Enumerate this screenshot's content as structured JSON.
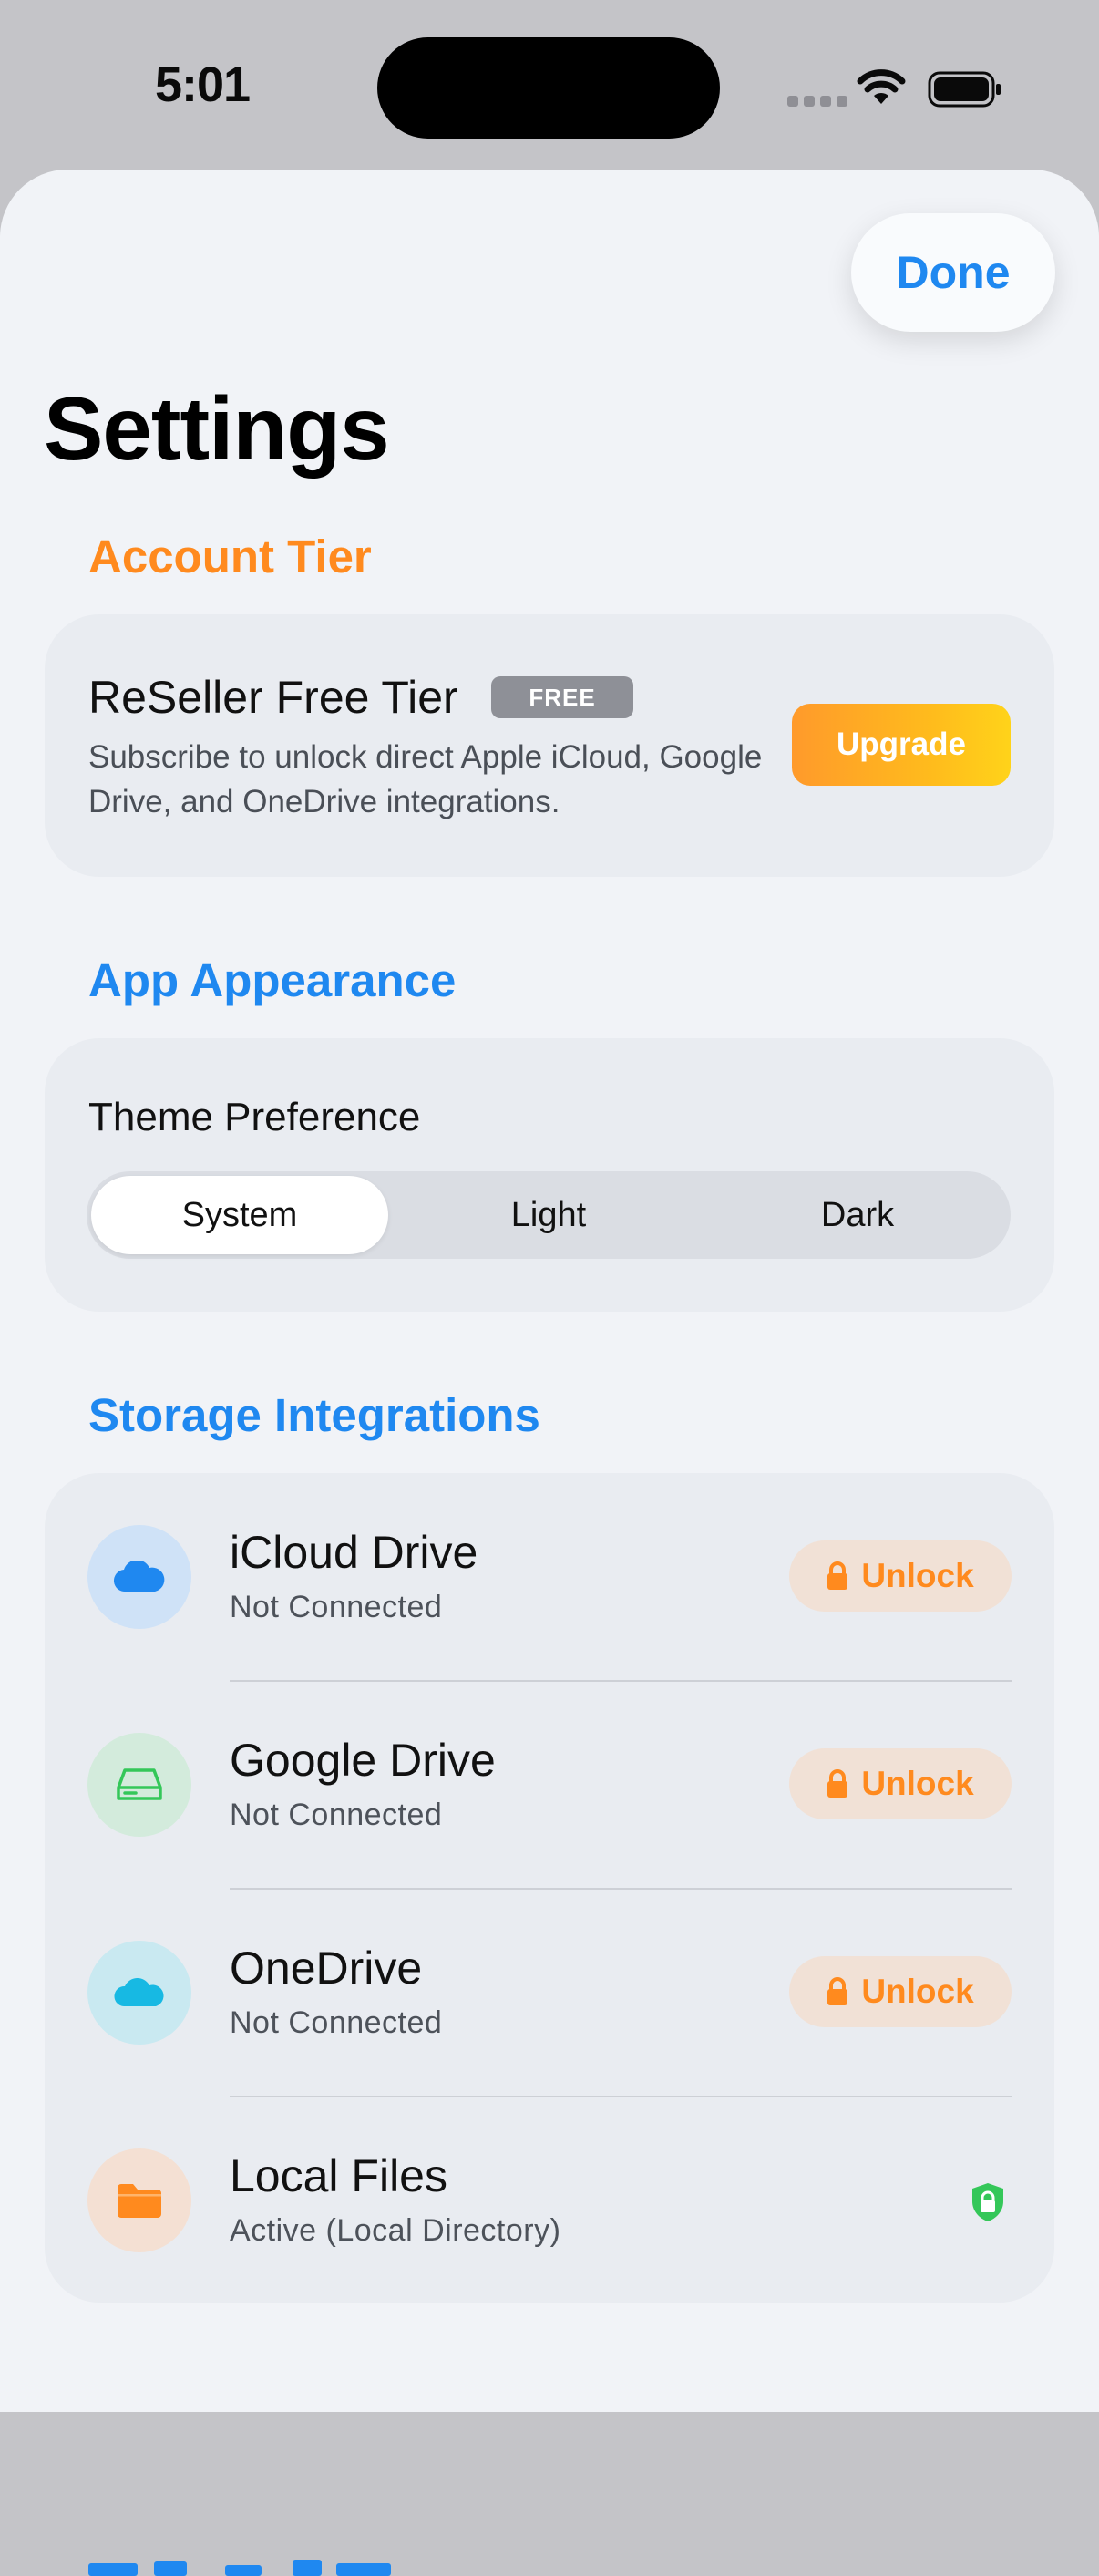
{
  "status_bar": {
    "time": "5:01"
  },
  "header": {
    "done_label": "Done",
    "title": "Settings"
  },
  "colors": {
    "accent_blue": "#1f88f0",
    "accent_orange": "#ff8a1e",
    "success_green": "#34c759"
  },
  "account_tier": {
    "header": "Account Tier",
    "name": "ReSeller Free Tier",
    "badge": "FREE",
    "description": "Subscribe to unlock direct Apple iCloud, Google Drive, and OneDrive integrations.",
    "upgrade_label": "Upgrade"
  },
  "appearance": {
    "header": "App Appearance",
    "theme_label": "Theme Preference",
    "options": [
      "System",
      "Light",
      "Dark"
    ],
    "selected": "System"
  },
  "storage": {
    "header": "Storage Integrations",
    "items": [
      {
        "title": "iCloud Drive",
        "status": "Not Connected",
        "action": "Unlock",
        "icon": "cloud-icon"
      },
      {
        "title": "Google Drive",
        "status": "Not Connected",
        "action": "Unlock",
        "icon": "drive-icon"
      },
      {
        "title": "OneDrive",
        "status": "Not Connected",
        "action": "Unlock",
        "icon": "cloud-icon"
      },
      {
        "title": "Local Files",
        "status": "Active (Local Directory)",
        "action": "",
        "icon": "folder-icon"
      }
    ]
  }
}
